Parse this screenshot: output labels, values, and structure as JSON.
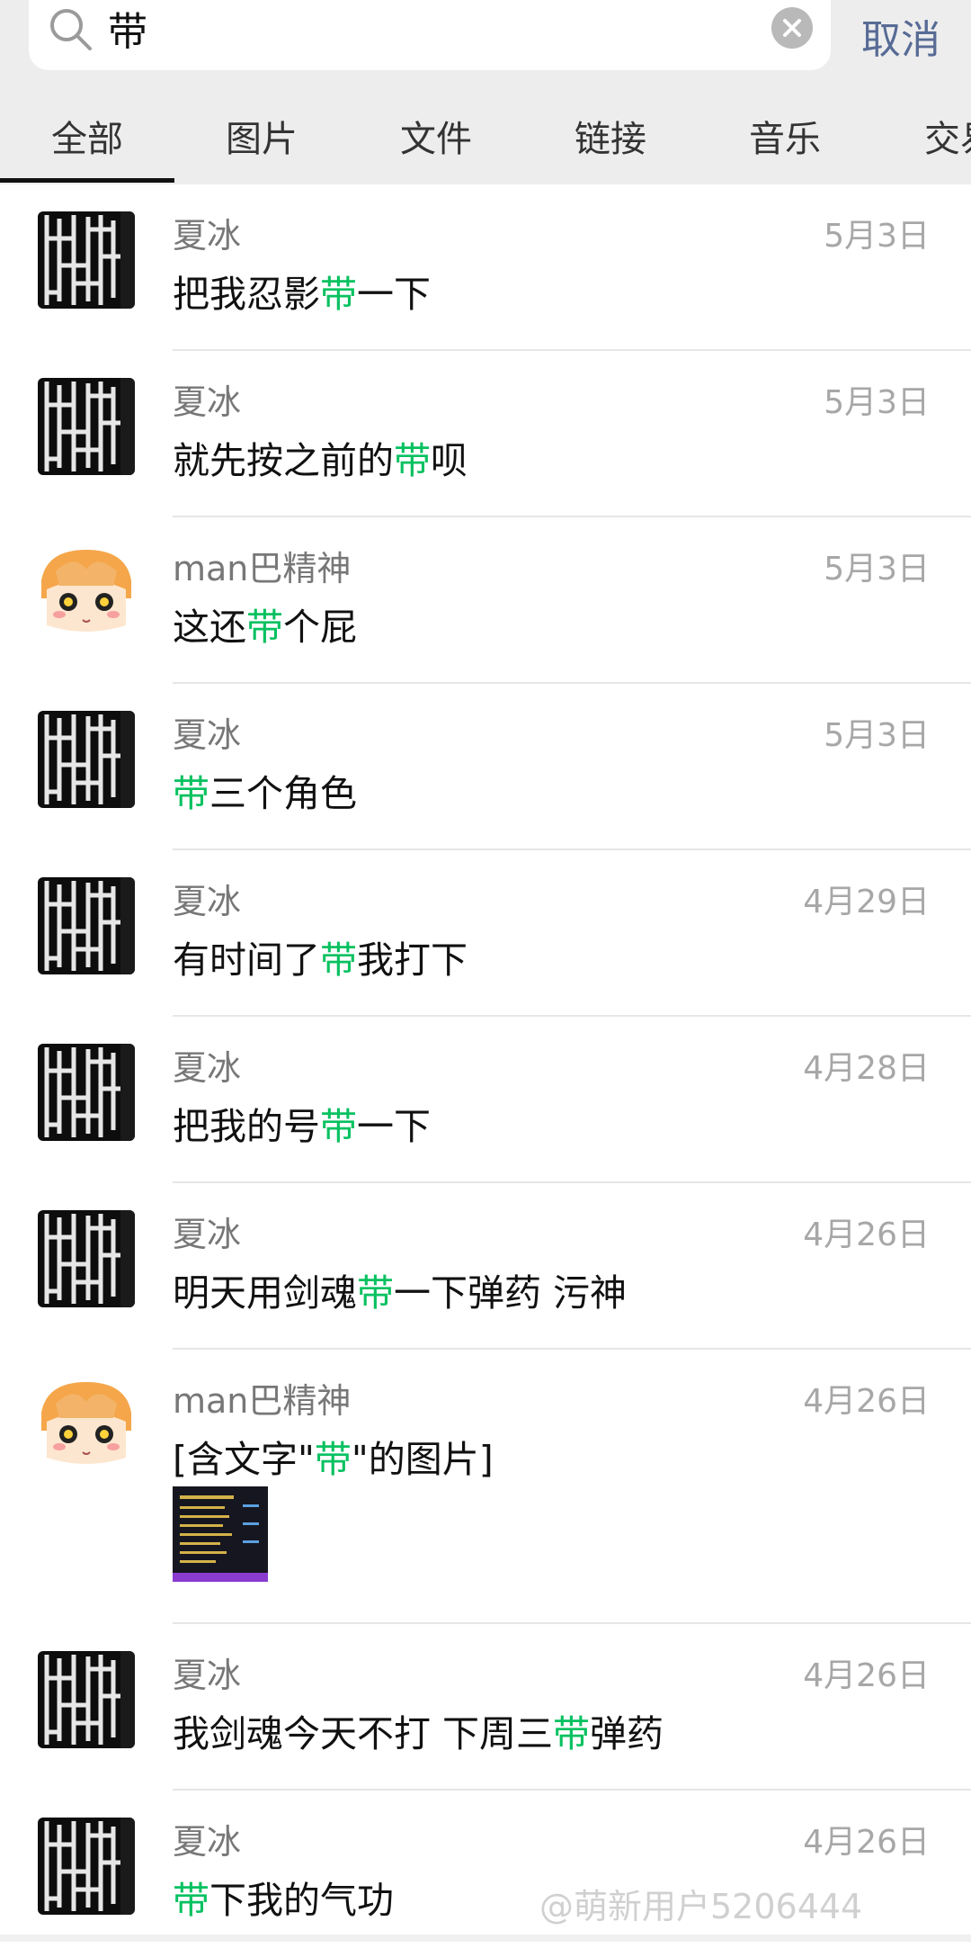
{
  "search": {
    "query": "带",
    "cancel_label": "取消"
  },
  "tabs": [
    "全部",
    "图片",
    "文件",
    "链接",
    "音乐",
    "交易"
  ],
  "colors": {
    "highlight": "#07c160",
    "cancel": "#576b95"
  },
  "results": [
    {
      "name": "夏冰",
      "date": "5月3日",
      "avatar": "lattice-avatar",
      "before": "把我忍影",
      "match": "带",
      "after": "一下"
    },
    {
      "name": "夏冰",
      "date": "5月3日",
      "avatar": "lattice-avatar",
      "before": "就先按之前的",
      "match": "带",
      "after": "呗"
    },
    {
      "name": "man巴精神",
      "date": "5月3日",
      "avatar": "anime-girl-avatar",
      "before": "这还",
      "match": "带",
      "after": "个屁"
    },
    {
      "name": "夏冰",
      "date": "5月3日",
      "avatar": "lattice-avatar",
      "before": "",
      "match": "带",
      "after": "三个角色"
    },
    {
      "name": "夏冰",
      "date": "4月29日",
      "avatar": "lattice-avatar",
      "before": "有时间了",
      "match": "带",
      "after": "我打下"
    },
    {
      "name": "夏冰",
      "date": "4月28日",
      "avatar": "lattice-avatar",
      "before": "把我的号",
      "match": "带",
      "after": "一下"
    },
    {
      "name": "夏冰",
      "date": "4月26日",
      "avatar": "lattice-avatar",
      "before": "明天用剑魂",
      "match": "带",
      "after": "一下弹药 污神"
    },
    {
      "name": "man巴精神",
      "date": "4月26日",
      "avatar": "anime-girl-avatar",
      "before": "[含文字\"",
      "match": "带",
      "after": "\"的图片]",
      "has_thumbnail": true
    },
    {
      "name": "夏冰",
      "date": "4月26日",
      "avatar": "lattice-avatar",
      "before": "我剑魂今天不打 下周三",
      "match": "带",
      "after": "弹药"
    },
    {
      "name": "夏冰",
      "date": "4月26日",
      "avatar": "lattice-avatar",
      "before": "",
      "match": "带",
      "after": "下我的气功"
    }
  ],
  "watermark": "@萌新用户5206444"
}
